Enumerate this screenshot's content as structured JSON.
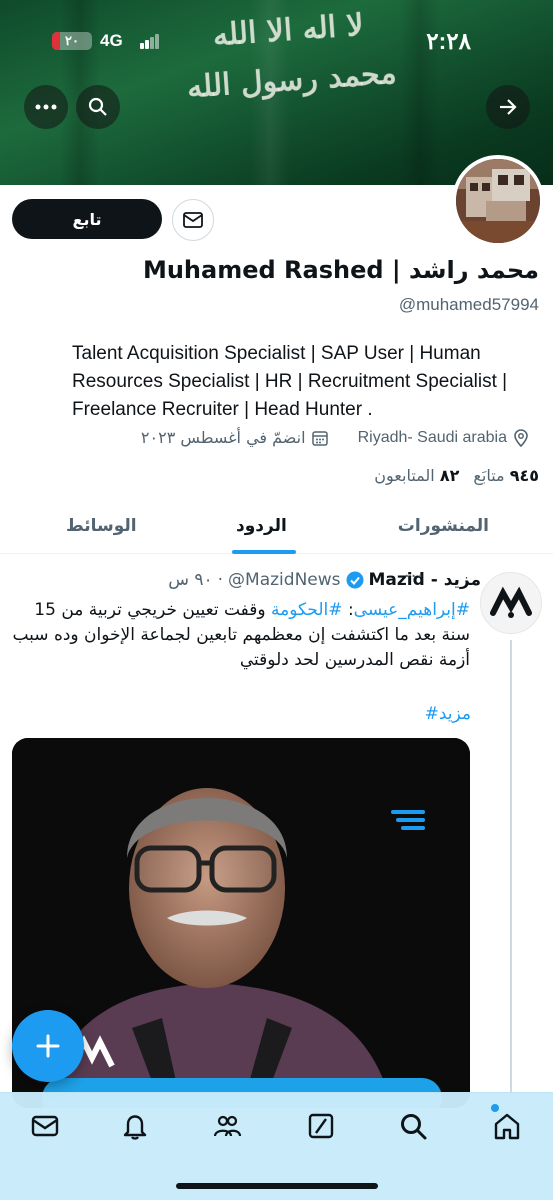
{
  "status_bar": {
    "time": "٢:٢٨",
    "network": "4G",
    "battery": "٢٠",
    "battery_level": 0.2
  },
  "banner": {
    "script_line1": "لا اله الا الله",
    "script_line2": "محمد رسول الله"
  },
  "profile": {
    "follow_label": "تابع",
    "name": "Muhamed Rashed | محمد راشد",
    "handle": "@muhamed57994",
    "bio": "Talent Acquisition Specialist | SAP User | Human Resources Specialist | HR | Recruitment Specialist | Freelance Recruiter | Head Hunter .",
    "location": "Riyadh- Saudi arabia",
    "joined": "انضمّ في أغسطس ٢٠٢٣",
    "following_count": "٩٤٥",
    "following_label": "متابَع",
    "followers_count": "٨٢",
    "followers_label": "المتابعون"
  },
  "tabs": [
    {
      "label": "المنشورات",
      "active": false
    },
    {
      "label": "الردود",
      "active": true
    },
    {
      "label": "الوسائط",
      "active": false
    }
  ],
  "tweet": {
    "display_name": "مزيد - Mazid",
    "handle": "@MazidNews",
    "time": "٩٠ س",
    "dot": "·",
    "more": "···",
    "hashtag_person": "#إبراهيم_عيسى",
    "colon": ":",
    "hashtag_gov": "#الحكومة",
    "text": "وقفت تعيين خريجي تربية من 15 سنة بعد ما اكتشفت إن معظمهم تابعين لجماعة الإخوان وده سبب أزمة نقص المدرسين لحد دلوقتي",
    "hashtag_end": "#مزيد"
  },
  "fab": {
    "label": "+"
  },
  "colors": {
    "accent": "#1d9bf0",
    "text": "#0f1419",
    "secondary": "#536471",
    "banner_green": "#145531",
    "nav_bg": "#c8ebfa"
  },
  "nav": {
    "icons": [
      "mail-icon",
      "bell-icon",
      "people-icon",
      "grok-icon",
      "search-icon",
      "home-icon"
    ]
  }
}
